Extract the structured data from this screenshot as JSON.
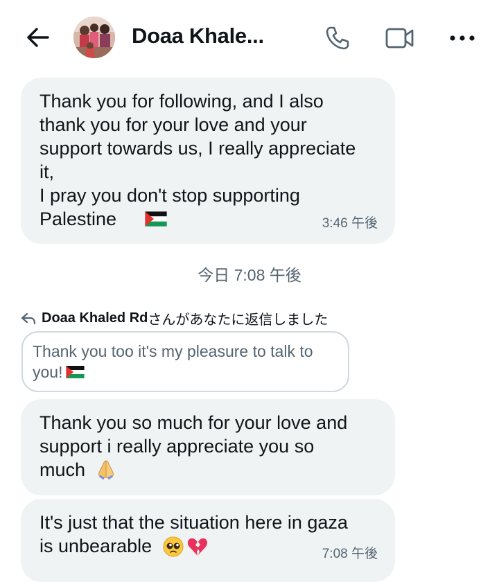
{
  "header": {
    "title": "Doaa Khale...",
    "back_icon": "arrow-left-icon",
    "call_icon": "phone-icon",
    "video_icon": "video-camera-icon",
    "more_icon": "more-dots-icon"
  },
  "messages": [
    {
      "text": "Thank you for following, and I also\nthank you for your love and your\nsupport towards us, I really appreciate\nit,\nI pray you don't stop supporting\nPalestine",
      "emoji": "palestine-flag",
      "time": "3:46 午後"
    },
    {
      "text": "Thank you so much for your love and\nsupport i really appreciate you so\nmuch",
      "emoji": "folded-hands"
    },
    {
      "text": "It's just that the situation here in gaza\nis unbearable",
      "emoji": "pleading-face broken-heart",
      "time": "7:08 午後"
    }
  ],
  "date_divider": "今日 7:08 午後",
  "reply": {
    "name": "Doaa Khaled Rd",
    "suffix": "さんがあなたに返信しました",
    "quoted_text": "Thank you too it's my pleasure to talk to\nyou!",
    "quoted_emoji": "palestine-flag"
  },
  "colors": {
    "bubble": "#eff3f4",
    "muted_text": "#536471",
    "text": "#0f1419",
    "quote_border": "#cfd9de"
  }
}
